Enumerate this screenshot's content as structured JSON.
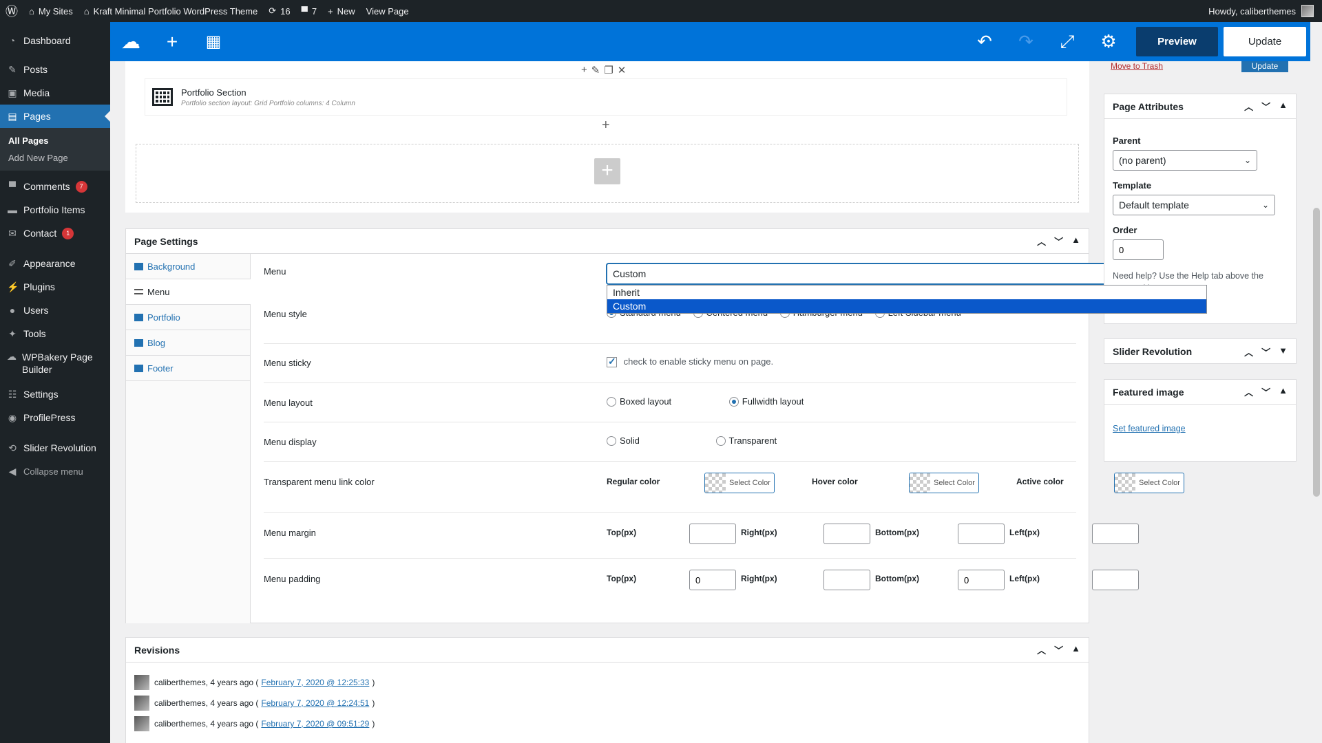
{
  "admin_bar": {
    "wp_logo": "wordpress-icon",
    "my_sites": "My Sites",
    "site_name": "Kraft Minimal Portfolio WordPress Theme",
    "updates_count": "16",
    "comments_count": "7",
    "new_label": "New",
    "view_page": "View Page",
    "howdy": "Howdy, caliberthemes"
  },
  "sidebar": {
    "items": [
      {
        "label": "Dashboard",
        "icon": "dashboard-icon"
      },
      {
        "label": "Posts",
        "icon": "pin-icon"
      },
      {
        "label": "Media",
        "icon": "media-icon"
      },
      {
        "label": "Pages",
        "icon": "pages-icon"
      },
      {
        "label": "Comments",
        "icon": "comment-icon",
        "badge": "7"
      },
      {
        "label": "Portfolio Items",
        "icon": "folder-icon"
      },
      {
        "label": "Contact",
        "icon": "mail-icon",
        "badge": "1"
      },
      {
        "label": "Appearance",
        "icon": "brush-icon"
      },
      {
        "label": "Plugins",
        "icon": "plug-icon"
      },
      {
        "label": "Users",
        "icon": "user-icon"
      },
      {
        "label": "Tools",
        "icon": "wrench-icon"
      },
      {
        "label": "WPBakery Page Builder",
        "icon": "bakery-icon"
      },
      {
        "label": "Settings",
        "icon": "settings-icon"
      },
      {
        "label": "ProfilePress",
        "icon": "profilepress-icon"
      },
      {
        "label": "Slider Revolution",
        "icon": "slider-icon"
      },
      {
        "label": "Collapse menu",
        "icon": "collapse-icon"
      }
    ],
    "submenu": {
      "all_pages": "All Pages",
      "add_new": "Add New Page"
    }
  },
  "builder_toolbar": {
    "preview": "Preview",
    "update": "Update"
  },
  "builder_canvas": {
    "element_title": "Portfolio Section",
    "element_subtitle": "Portfolio section layout: Grid  Portfolio columns: 4 Column"
  },
  "page_settings": {
    "title": "Page Settings",
    "tabs": [
      "Background",
      "Menu",
      "Portfolio",
      "Blog",
      "Footer"
    ],
    "menu": {
      "label": "Menu",
      "value": "Custom",
      "options": [
        "Inherit",
        "Custom"
      ]
    },
    "menu_style": {
      "label": "Menu style",
      "options": [
        "Standard menu",
        "Centered menu",
        "Hamburger menu",
        "Left Sidebar menu"
      ]
    },
    "menu_sticky": {
      "label": "Menu sticky",
      "checkbox_text": "check to enable sticky menu on page."
    },
    "menu_layout": {
      "label": "Menu layout",
      "options": [
        "Boxed layout",
        "Fullwidth layout"
      ]
    },
    "menu_display": {
      "label": "Menu display",
      "options": [
        "Solid",
        "Transparent"
      ]
    },
    "transparent_link_color": {
      "label": "Transparent menu link color",
      "regular": "Regular color",
      "hover": "Hover color",
      "active": "Active color",
      "select_color": "Select Color"
    },
    "menu_margin": {
      "label": "Menu margin",
      "top": "Top(px)",
      "right": "Right(px)",
      "bottom": "Bottom(px)",
      "left": "Left(px)",
      "values": [
        "",
        "",
        "",
        ""
      ]
    },
    "menu_padding": {
      "label": "Menu padding",
      "top": "Top(px)",
      "right": "Right(px)",
      "bottom": "Bottom(px)",
      "left": "Left(px)",
      "values": [
        "0",
        "",
        "0",
        ""
      ]
    }
  },
  "revisions": {
    "title": "Revisions",
    "items": [
      {
        "author": "caliberthemes, 4 years ago (",
        "link": "February 7, 2020 @ 12:25:33",
        "end": ")"
      },
      {
        "author": "caliberthemes, 4 years ago (",
        "link": "February 7, 2020 @ 12:24:51",
        "end": ")"
      },
      {
        "author": "caliberthemes, 4 years ago (",
        "link": "February 7, 2020 @ 09:51:29",
        "end": ")"
      }
    ]
  },
  "right_sidebar": {
    "move_to_trash": "Move to Trash",
    "update_small": "Update",
    "page_attributes": {
      "title": "Page Attributes",
      "parent_label": "Parent",
      "parent_value": "(no parent)",
      "template_label": "Template",
      "template_value": "Default template",
      "order_label": "Order",
      "order_value": "0",
      "help": "Need help? Use the Help tab above the screen title."
    },
    "slider_revolution": "Slider Revolution",
    "featured_image": {
      "title": "Featured image",
      "link": "Set featured image"
    }
  }
}
